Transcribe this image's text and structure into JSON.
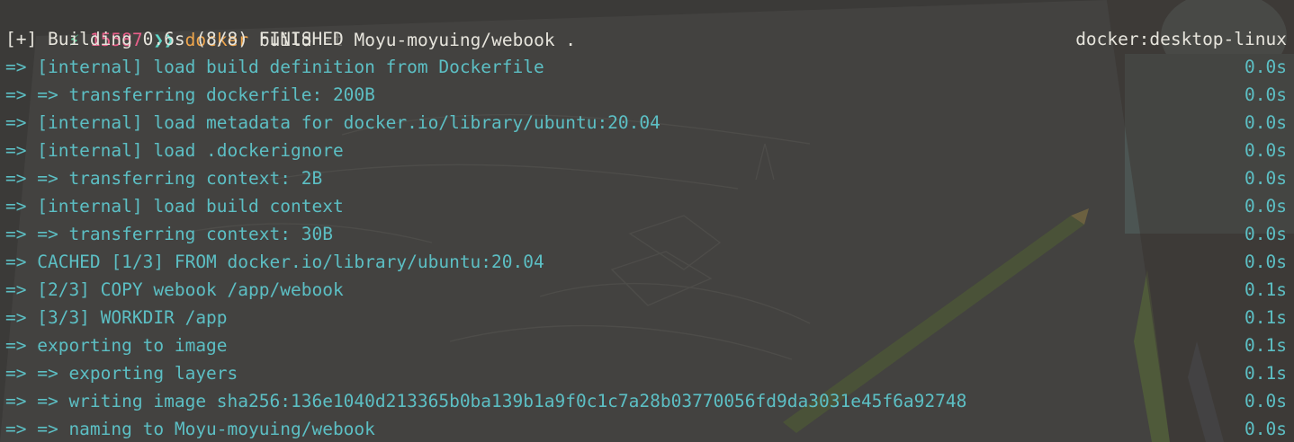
{
  "prompt": {
    "icon": "bolt-icon",
    "number": "15587",
    "chevrons": "❯❯",
    "command": "docker",
    "args": " build ",
    "flag": "-t",
    "target": " Moyu-moyuing/webook ."
  },
  "header": {
    "left": "[+] Building 0.6s (8/8) FINISHED",
    "right": "docker:desktop-linux"
  },
  "steps": [
    {
      "text": "=> [internal] load build definition from Dockerfile",
      "time": "0.0s"
    },
    {
      "text": "=> => transferring dockerfile: 200B",
      "time": "0.0s"
    },
    {
      "text": "=> [internal] load metadata for docker.io/library/ubuntu:20.04",
      "time": "0.0s"
    },
    {
      "text": "=> [internal] load .dockerignore",
      "time": "0.0s"
    },
    {
      "text": "=> => transferring context: 2B",
      "time": "0.0s"
    },
    {
      "text": "=> [internal] load build context",
      "time": "0.0s"
    },
    {
      "text": "=> => transferring context: 30B",
      "time": "0.0s"
    },
    {
      "text": "=> CACHED [1/3] FROM docker.io/library/ubuntu:20.04",
      "time": "0.0s"
    },
    {
      "text": "=> [2/3] COPY webook /app/webook",
      "time": "0.1s"
    },
    {
      "text": "=> [3/3] WORKDIR /app",
      "time": "0.1s"
    },
    {
      "text": "=> exporting to image",
      "time": "0.1s"
    },
    {
      "text": "=> => exporting layers",
      "time": "0.1s"
    },
    {
      "text": "=> => writing image sha256:136e1040d213365b0ba139b1a9f0c1c7a28b03770056fd9da3031e45f6a92748",
      "time": "0.0s"
    },
    {
      "text": "=> => naming to Moyu-moyuing/webook",
      "time": "0.0s"
    }
  ]
}
